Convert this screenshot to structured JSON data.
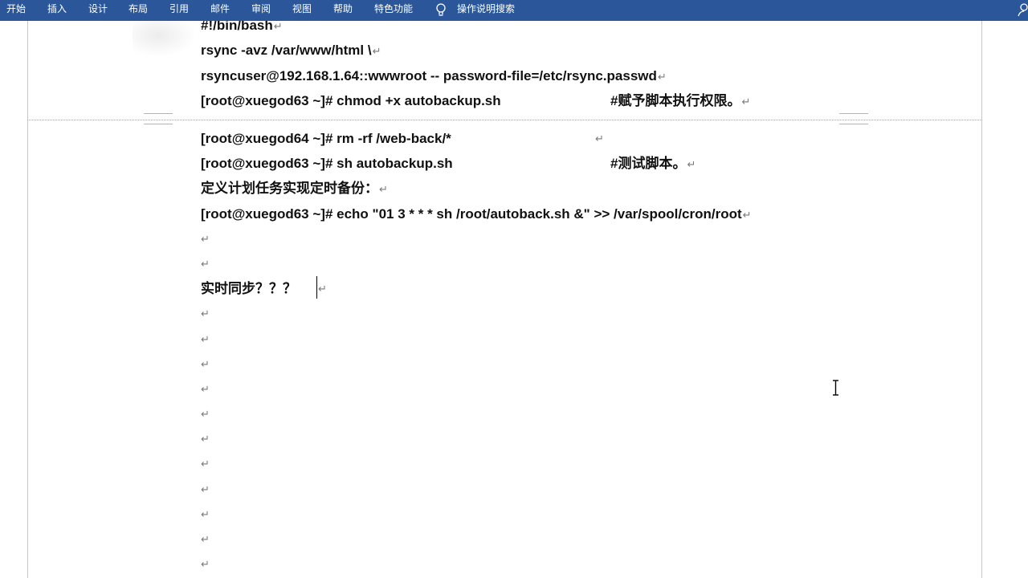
{
  "ribbon": {
    "tabs": [
      "开始",
      "插入",
      "设计",
      "布局",
      "引用",
      "邮件",
      "审阅",
      "视图",
      "帮助",
      "特色功能"
    ],
    "tell_me": "操作说明搜索",
    "background_color": "#2b579a"
  },
  "document": {
    "paragraph_mark": "↵",
    "lines": [
      "#!/bin/bash",
      "rsync -avz /var/www/html \\",
      "rsyncuser@192.168.1.64::wwwroot -- password-file=/etc/rsync.passwd",
      "[root@xuegod63 ~]# chmod +x autobackup.sh",
      "[root@xuegod64 ~]# rm -rf /web-back/*",
      "[root@xuegod63 ~]# sh autobackup.sh",
      "定义计划任务实现定时备份：",
      "[root@xuegod63 ~]# echo \"01 3 * * * sh /root/autoback.sh &\" >> /var/spool/cron/root",
      "实时同步？？？"
    ],
    "comments": [
      "#赋予脚本执行权限。",
      "#测试脚本。"
    ]
  }
}
